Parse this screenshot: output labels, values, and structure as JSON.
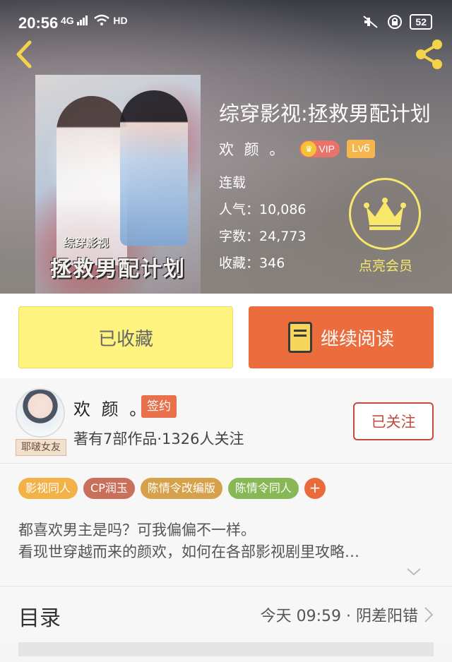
{
  "status_bar": {
    "time": "20:56",
    "network": "4G",
    "hd": "HD",
    "battery": "52"
  },
  "book": {
    "title": "综穿影视:拯救男配计划",
    "author": "欢 颜 。",
    "vip_label": "VIP",
    "level": "Lv6",
    "status": "连载",
    "popularity_label": "人气：",
    "popularity": "10,086",
    "word_count_label": "字数：",
    "word_count": "24,773",
    "favorites_label": "收藏：",
    "favorites": "346",
    "cover_title": "拯救男配计划",
    "cover_subtitle": "综穿影视"
  },
  "vip_member": {
    "label": "点亮会员"
  },
  "actions": {
    "collected_label": "已收藏",
    "read_label": "继续阅读"
  },
  "author_card": {
    "name": "欢 颜 。",
    "avatar_tag": "耶啵女友",
    "sign_badge": "签约",
    "stats": "著有7部作品·1326人关注",
    "follow_label": "已关注"
  },
  "tags": [
    {
      "label": "影视同人",
      "color": "#f4b148"
    },
    {
      "label": "CP润玉",
      "color": "#c8705a"
    },
    {
      "label": "陈情令改编版",
      "color": "#d6a14a"
    },
    {
      "label": "陈情令同人",
      "color": "#87b855"
    }
  ],
  "tag_add": "+",
  "synopsis": {
    "line1": "都喜欢男主是吗？可我偏偏不一样。",
    "line2": "看现世穿越而来的颜欢，如何在各部影视剧里攻略…"
  },
  "catalog": {
    "title": "目录",
    "update": "今天 09:59 · 阴差阳错"
  },
  "icons": {
    "back": "back-chevron-icon",
    "share": "share-icon",
    "crown": "crown-icon",
    "book": "book-icon",
    "expand": "chevron-down-icon",
    "catalog_arrow": "chevron-right-icon"
  },
  "colors": {
    "primary_orange": "#eb6c3c",
    "collected_yellow": "#fdf37e",
    "gold": "#f7e86b",
    "follow_red": "#c34a3e"
  }
}
